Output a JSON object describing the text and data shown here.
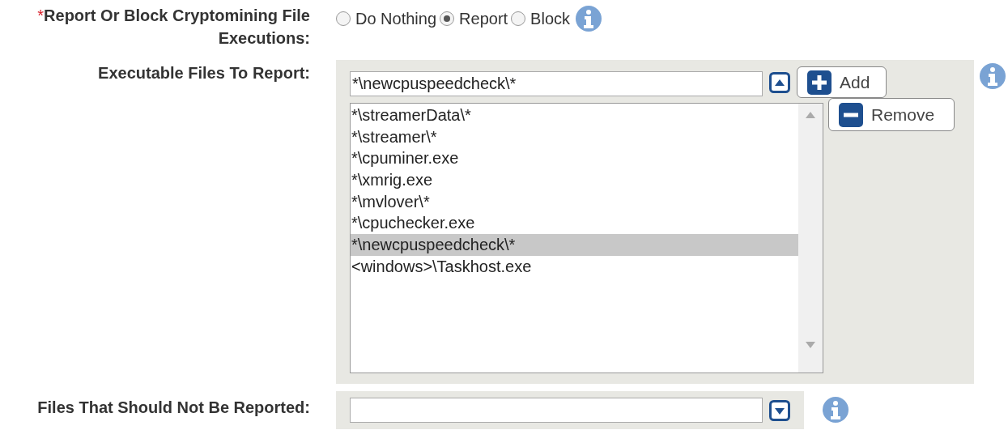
{
  "fields": [
    {
      "kind": "radio",
      "required_mark": "*",
      "label": "Report Or Block Cryptomining File Executions:",
      "options": [
        {
          "label": "Do Nothing",
          "selected": false
        },
        {
          "label": "Report",
          "selected": true
        },
        {
          "label": "Block",
          "selected": false
        }
      ]
    },
    {
      "kind": "list",
      "label": "Executable Files To Report:",
      "value": "*\\newcpuspeedcheck\\*",
      "add_label": "Add",
      "remove_label": "Remove",
      "items": [
        {
          "text": "*\\streamerData\\*",
          "selected": false
        },
        {
          "text": "*\\streamer\\*",
          "selected": false
        },
        {
          "text": "*\\cpuminer.exe",
          "selected": false
        },
        {
          "text": "*\\xmrig.exe",
          "selected": false
        },
        {
          "text": "*\\mvlover\\*",
          "selected": false
        },
        {
          "text": "*\\cpuchecker.exe",
          "selected": false
        },
        {
          "text": "*\\newcpuspeedcheck\\*",
          "selected": true
        },
        {
          "text": "<windows>\\Taskhost.exe",
          "selected": false
        }
      ]
    },
    {
      "kind": "collapsed",
      "label": "Files That Should Not Be Reported:"
    }
  ]
}
